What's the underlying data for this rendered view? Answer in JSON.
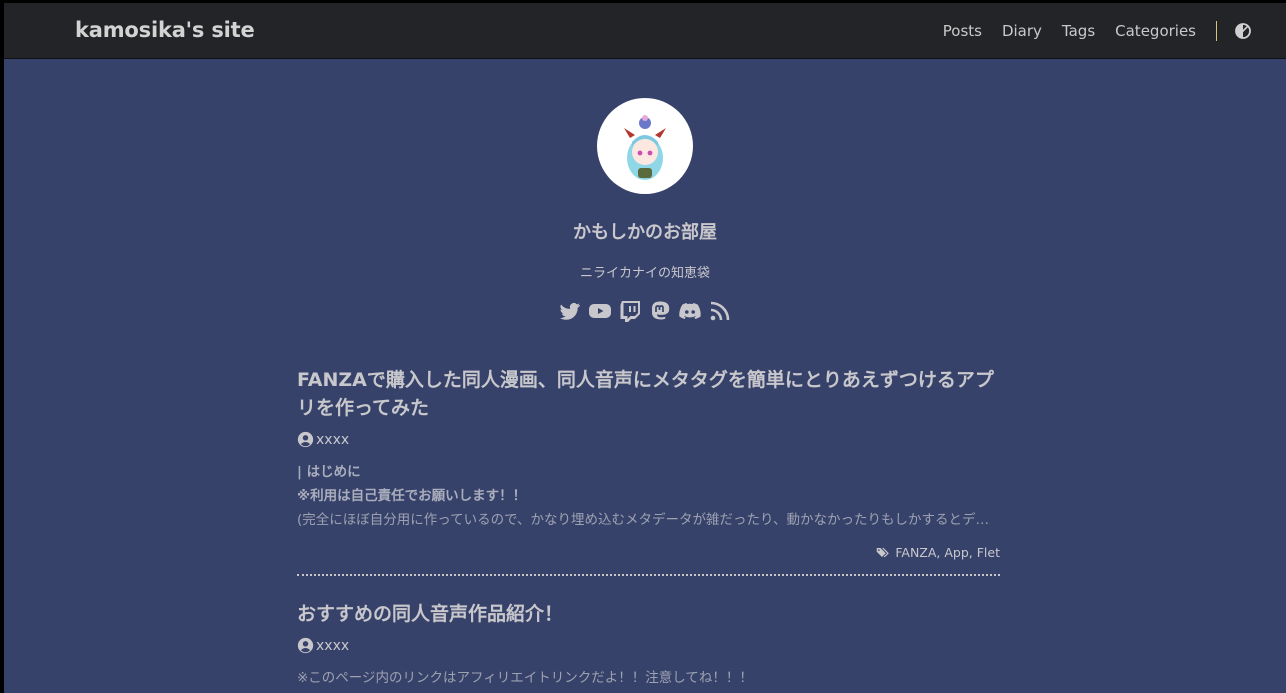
{
  "header": {
    "site_title": "kamosika's site",
    "nav": [
      "Posts",
      "Diary",
      "Tags",
      "Categories"
    ],
    "theme_toggle_icon": "half-circle-contrast-icon"
  },
  "profile": {
    "name": "かもしかのお部屋",
    "subtitle": "ニライカナイの知恵袋",
    "socials": [
      "twitter-icon",
      "youtube-icon",
      "twitch-icon",
      "mastodon-icon",
      "discord-icon",
      "rss-icon"
    ]
  },
  "posts": [
    {
      "title": "FANZAで購入した同人漫画、同人音声にメタタグを簡単にとりあえずつけるアプリを作ってみた",
      "author": "xxxx",
      "summary": {
        "heading": "| はじめに",
        "line1": "※利用は自己責任でお願いします！！",
        "line2": "(完全にほぼ自分用に作っているので、かなり埋め込むメタデータが雑だったり、動かなかったりもしかするとデータを..."
      },
      "tags": "FANZA, App, Flet"
    },
    {
      "title": "おすすめの同人音声作品紹介！",
      "author": "xxxx",
      "summary": {
        "line1": "※このページ内のリンクはアフィリエイトリンクだよ！！注意してね！！！"
      }
    }
  ],
  "colors": {
    "page_bg": "#37426a",
    "header_bg": "#232427",
    "text": "#c8c8cc",
    "accent_separator": "#d9c27a"
  }
}
